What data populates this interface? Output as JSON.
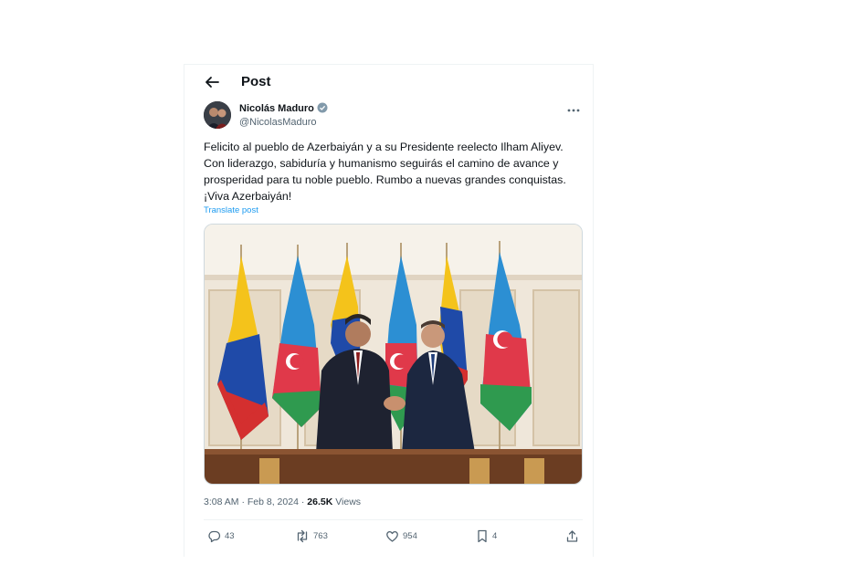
{
  "header": {
    "title": "Post"
  },
  "author": {
    "name": "Nicolás Maduro",
    "handle": "@NicolasMaduro"
  },
  "tweet": {
    "lines": [
      "Felicito al pueblo de Azerbaiyán y a su Presidente reelecto Ilham Aliyev.",
      "Con liderazgo, sabiduría y humanismo seguirás el camino de avance y",
      "prosperidad para tu noble pueblo. Rumbo a nuevas grandes conquistas.",
      "¡Viva Azerbaiyán!"
    ],
    "translate_label": "Translate post"
  },
  "meta": {
    "time": "3:08 AM",
    "separator": "·",
    "date": "Feb 8, 2024",
    "views_count": "26.5K",
    "views_label": "Views"
  },
  "actions": {
    "replies": "43",
    "reposts": "763",
    "likes": "954",
    "bookmarks": "4"
  },
  "icons": [
    "back-arrow-icon",
    "verified-badge-icon",
    "more-icon",
    "reply-icon",
    "repost-icon",
    "like-icon",
    "bookmark-icon",
    "share-icon"
  ],
  "colors": {
    "accent": "#1d9bf0",
    "text": "#0f1419",
    "muted": "#536471"
  }
}
